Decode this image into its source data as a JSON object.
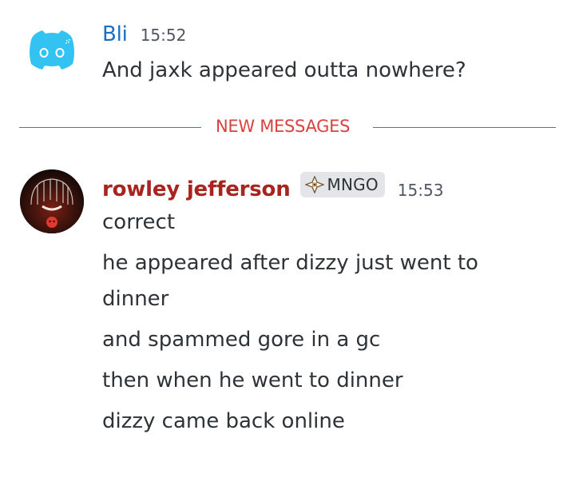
{
  "messages": [
    {
      "author": "Bli",
      "author_color": "#1b6fc3",
      "avatar_icon": "discord-logo-icon",
      "timestamp": "15:52",
      "lines": [
        "And jaxk appeared outta nowhere?"
      ]
    },
    {
      "author": "rowley jefferson",
      "author_color": "#a7241f",
      "avatar_icon": "user-avatar",
      "tag": {
        "icon": "mango-icon",
        "label": "MNGO"
      },
      "timestamp": "15:53",
      "lines": [
        "correct",
        "he appeared after dizzy just went to",
        "dinner",
        "and spammed gore in a gc",
        "then when he went to dinner",
        "dizzy came back online"
      ]
    }
  ],
  "divider": {
    "label": "NEW MESSAGES",
    "color": "#d9423f"
  }
}
